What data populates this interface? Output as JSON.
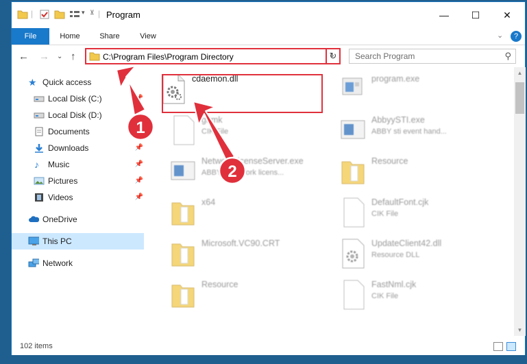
{
  "window": {
    "title": "Program",
    "controls": {
      "minimize": "—",
      "maximize": "☐",
      "close": "✕"
    }
  },
  "ribbon": {
    "tabs": [
      "File",
      "Home",
      "Share",
      "View"
    ],
    "help_glyph": "?",
    "expand_glyph": "⌄"
  },
  "navigation": {
    "back": "←",
    "forward": "→",
    "recent": "⌄",
    "up": "↑",
    "address_path": "C:\\Program Files\\Program Directory",
    "address_dropdown": "⌄",
    "refresh": "↻",
    "search_placeholder": "Search Program",
    "search_icon": "⚲"
  },
  "sidebar": {
    "items": [
      {
        "label": "Quick access",
        "icon": "star-icon",
        "pinned": false
      },
      {
        "label": "Local Disk (C:)",
        "icon": "drive-icon",
        "pinned": true
      },
      {
        "label": "Local Disk (D:)",
        "icon": "drive-icon",
        "pinned": false
      },
      {
        "label": "Documents",
        "icon": "documents-icon",
        "pinned": false
      },
      {
        "label": "Downloads",
        "icon": "download-arrow-icon",
        "pinned": true
      },
      {
        "label": "Music",
        "icon": "music-note-icon",
        "pinned": true
      },
      {
        "label": "Pictures",
        "icon": "pictures-icon",
        "pinned": true
      },
      {
        "label": "Videos",
        "icon": "film-icon",
        "pinned": true
      },
      {
        "label": "OneDrive",
        "icon": "cloud-icon",
        "pinned": false
      },
      {
        "label": "This PC",
        "icon": "monitor-icon",
        "pinned": false,
        "selected": true
      },
      {
        "label": "Network",
        "icon": "network-icon",
        "pinned": false
      }
    ],
    "pin_glyph": "📌"
  },
  "files": [
    {
      "name": "cdaemon.dll",
      "sub": "",
      "icon": "dll-gear-icon",
      "highlight": true
    },
    {
      "name": "program.exe",
      "sub": "",
      "icon": "exe-icon"
    },
    {
      "name": "glrmk",
      "sub": "CIK File",
      "icon": "blank-file-icon"
    },
    {
      "name": "AbbyySTI.exe",
      "sub": "ABBY sti event hand...",
      "icon": "app-window-icon"
    },
    {
      "name": "NetworkLicenseServer.exe",
      "sub": "ABBYY Network licens...",
      "icon": "app-window-icon"
    },
    {
      "name": "Resource",
      "sub": "",
      "icon": "folder-icon"
    },
    {
      "name": "x64",
      "sub": "",
      "icon": "folder-icon"
    },
    {
      "name": "DefaultFont.cjk",
      "sub": "CIK File",
      "icon": "blank-file-icon"
    },
    {
      "name": "Microsoft.VC90.CRT",
      "sub": "",
      "icon": "folder-icon"
    },
    {
      "name": "UpdateClient42.dll",
      "sub": "Resource DLL",
      "icon": "dll-gear-icon"
    },
    {
      "name": "Resource",
      "sub": "",
      "icon": "folder-icon"
    },
    {
      "name": "FastNml.cjk",
      "sub": "CIK File",
      "icon": "blank-file-icon"
    }
  ],
  "status": {
    "item_count": "102 items"
  },
  "annotations": {
    "step1": "1",
    "step2": "2",
    "color": "#e0303c"
  }
}
